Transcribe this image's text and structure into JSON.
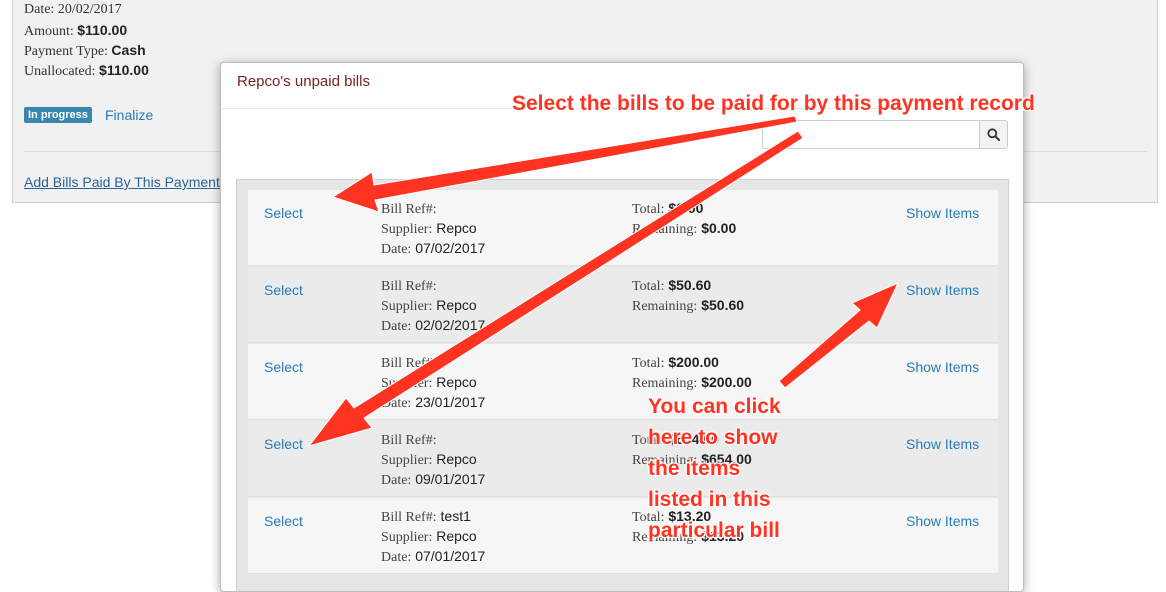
{
  "payment": {
    "date_label": "Date:",
    "date_value": "20/02/2017",
    "amount_label": "Amount:",
    "amount_value": "$110.00",
    "type_label": "Payment Type:",
    "type_value": "Cash",
    "unallocated_label": "Unallocated:",
    "unallocated_value": "$110.00",
    "status_badge": "In progress",
    "finalize_label": "Finalize",
    "add_bills_label": "Add Bills Paid By This Payment"
  },
  "modal": {
    "title": "Repco's unpaid bills",
    "search_placeholder": "",
    "search_value": ""
  },
  "bill_labels": {
    "ref": "Bill Ref#:",
    "supplier": "Supplier:",
    "date": "Date:",
    "total": "Total:",
    "remaining": "Remaining:",
    "select": "Select",
    "show_items": "Show Items"
  },
  "bills": [
    {
      "ref": "",
      "supplier": "Repco",
      "date": "07/02/2017",
      "total": "$0.00",
      "remaining": "$0.00"
    },
    {
      "ref": "",
      "supplier": "Repco",
      "date": "02/02/2017",
      "total": "$50.60",
      "remaining": "$50.60"
    },
    {
      "ref": "",
      "supplier": "Repco",
      "date": "23/01/2017",
      "total": "$200.00",
      "remaining": "$200.00"
    },
    {
      "ref": "",
      "supplier": "Repco",
      "date": "09/01/2017",
      "total": "$654.00",
      "remaining": "$654.00"
    },
    {
      "ref": "test1",
      "supplier": "Repco",
      "date": "07/01/2017",
      "total": "$13.20",
      "remaining": "$13.20"
    }
  ],
  "annotations": {
    "top_callout": "Select the bills to be paid for by this payment record",
    "note_line1": "You can click",
    "note_line2": "here to show",
    "note_line3": "the items",
    "note_line4": "listed in this",
    "note_line5": "particular bill",
    "color": "#ff3322"
  },
  "icons": {
    "search": "search-icon"
  }
}
